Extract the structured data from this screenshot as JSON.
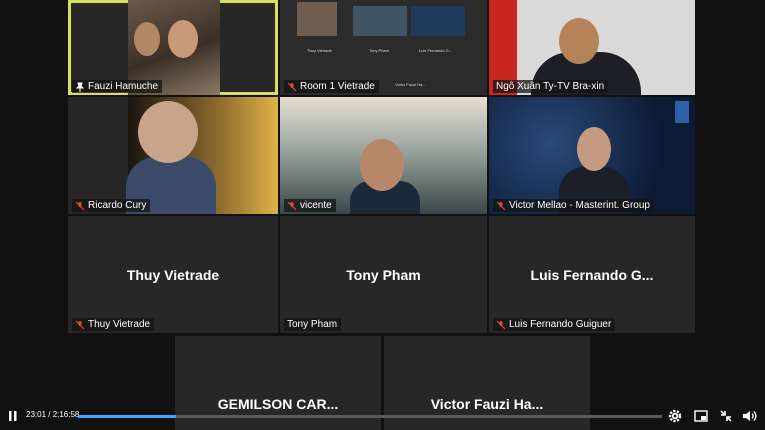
{
  "participants": [
    {
      "name": "Fauzi Hamuche",
      "muted": false,
      "active": true
    },
    {
      "name": "Room 1 Vietrade",
      "muted": true
    },
    {
      "name": "Ngô Xuân Ty-TV Bra-xin",
      "muted": false
    },
    {
      "name": "Ricardo Cury",
      "muted": true
    },
    {
      "name": "vicente",
      "muted": true
    },
    {
      "name": "Victor Mellao - Masterint. Group",
      "muted": true
    },
    {
      "name": "Thuy Vietrade",
      "display": "Thuy Vietrade",
      "muted": true
    },
    {
      "name": "Tony Pham",
      "display": "Tony Pham",
      "muted": false
    },
    {
      "name": "Luis Fernando Guiguer",
      "display": "Luis Fernando G...",
      "muted": true
    },
    {
      "display": "GEMILSON CAR..."
    },
    {
      "display": "Victor Fauzi Ha..."
    }
  ],
  "room_thumbs": [
    "Thuy Vietrade",
    "Tony Pham",
    "Luis Fernando G...",
    "Victor Fauzi Ha..."
  ],
  "player": {
    "current_time": "23:01",
    "duration": "2:16:58",
    "time_display": "23:01 / 2:16:58",
    "progress": 0.168
  },
  "colors": {
    "active_outline": "#d7e05a",
    "mute_red": "#e5483b",
    "progress": "#3ea6ff"
  },
  "icons": [
    "pause-icon",
    "settings-gear-icon",
    "picture-in-picture-icon",
    "fullscreen-exit-icon",
    "volume-icon"
  ]
}
